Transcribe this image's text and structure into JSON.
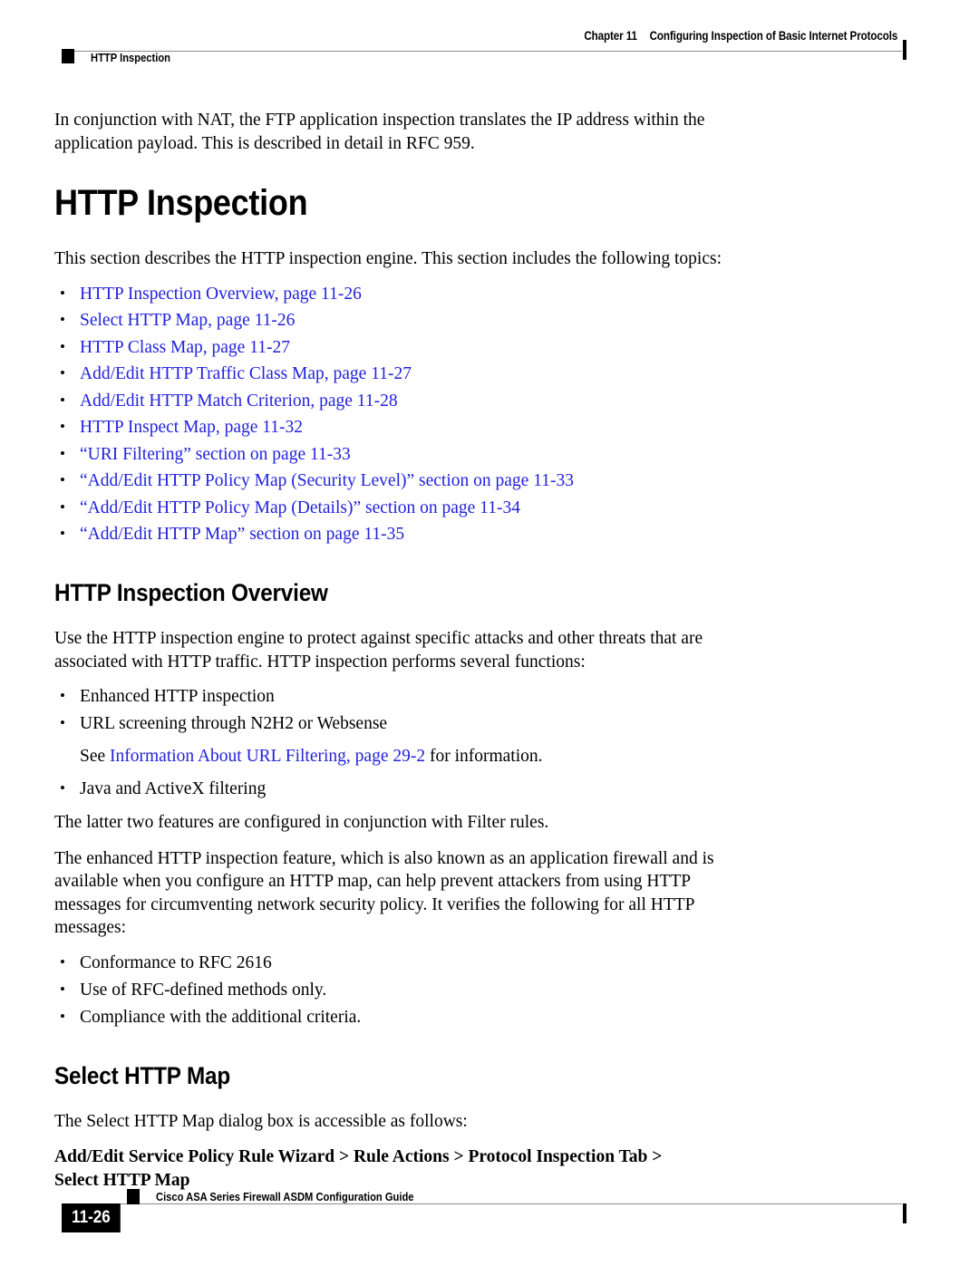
{
  "header": {
    "chapter_number": "Chapter 11",
    "chapter_title": "Configuring Inspection of Basic Internet Protocols",
    "section_name": "HTTP Inspection"
  },
  "intro_paragraph": "In conjunction with NAT, the FTP application inspection translates the IP address within the application payload. This is described in detail in RFC 959.",
  "title": "HTTP Inspection",
  "topics_lead": "This section describes the HTTP inspection engine. This section includes the following topics:",
  "topics": [
    "HTTP Inspection Overview, page 11-26",
    "Select HTTP Map, page 11-26",
    "HTTP Class Map, page 11-27",
    "Add/Edit HTTP Traffic Class Map, page 11-27",
    "Add/Edit HTTP Match Criterion, page 11-28",
    "HTTP Inspect Map, page 11-32",
    "“URI Filtering” section on page 11-33",
    "“Add/Edit HTTP Policy Map (Security Level)” section on page 11-33",
    "“Add/Edit HTTP Policy Map (Details)” section on page 11-34",
    "“Add/Edit HTTP Map” section on page 11-35"
  ],
  "overview": {
    "heading": "HTTP Inspection Overview",
    "paragraph": "Use the HTTP inspection engine to protect against specific attacks and other threats that are associated with HTTP traffic. HTTP inspection performs several functions:",
    "functions": [
      "Enhanced HTTP inspection",
      "URL screening through N2H2 or Websense"
    ],
    "see_prefix": "See ",
    "see_link": "Information About URL Filtering, page 29-2",
    "see_suffix": " for information.",
    "function_last": "Java and ActiveX filtering",
    "latter_paragraph": "The latter two features are configured in conjunction with Filter rules.",
    "enhanced_paragraph": "The enhanced HTTP inspection feature, which is also known as an application firewall and is available when you configure an HTTP map, can help prevent attackers from using HTTP messages for circumventing network security policy. It verifies the following for all HTTP messages:",
    "criteria": [
      "Conformance to RFC 2616",
      "Use of RFC-defined methods only.",
      "Compliance with the additional criteria."
    ]
  },
  "select_http_map": {
    "heading": "Select HTTP Map",
    "paragraph": "The Select HTTP Map dialog box is accessible as follows:",
    "path_line1": "Add/Edit Service Policy Rule Wizard > Rule Actions > Protocol Inspection Tab >",
    "path_line2": "Select HTTP Map"
  },
  "footer": {
    "guide_title": "Cisco ASA Series Firewall ASDM Configuration Guide",
    "page_number": "11-26"
  },
  "colors": {
    "link": "#2222dd",
    "rule": "#8a8a8a",
    "text": "#000000"
  }
}
